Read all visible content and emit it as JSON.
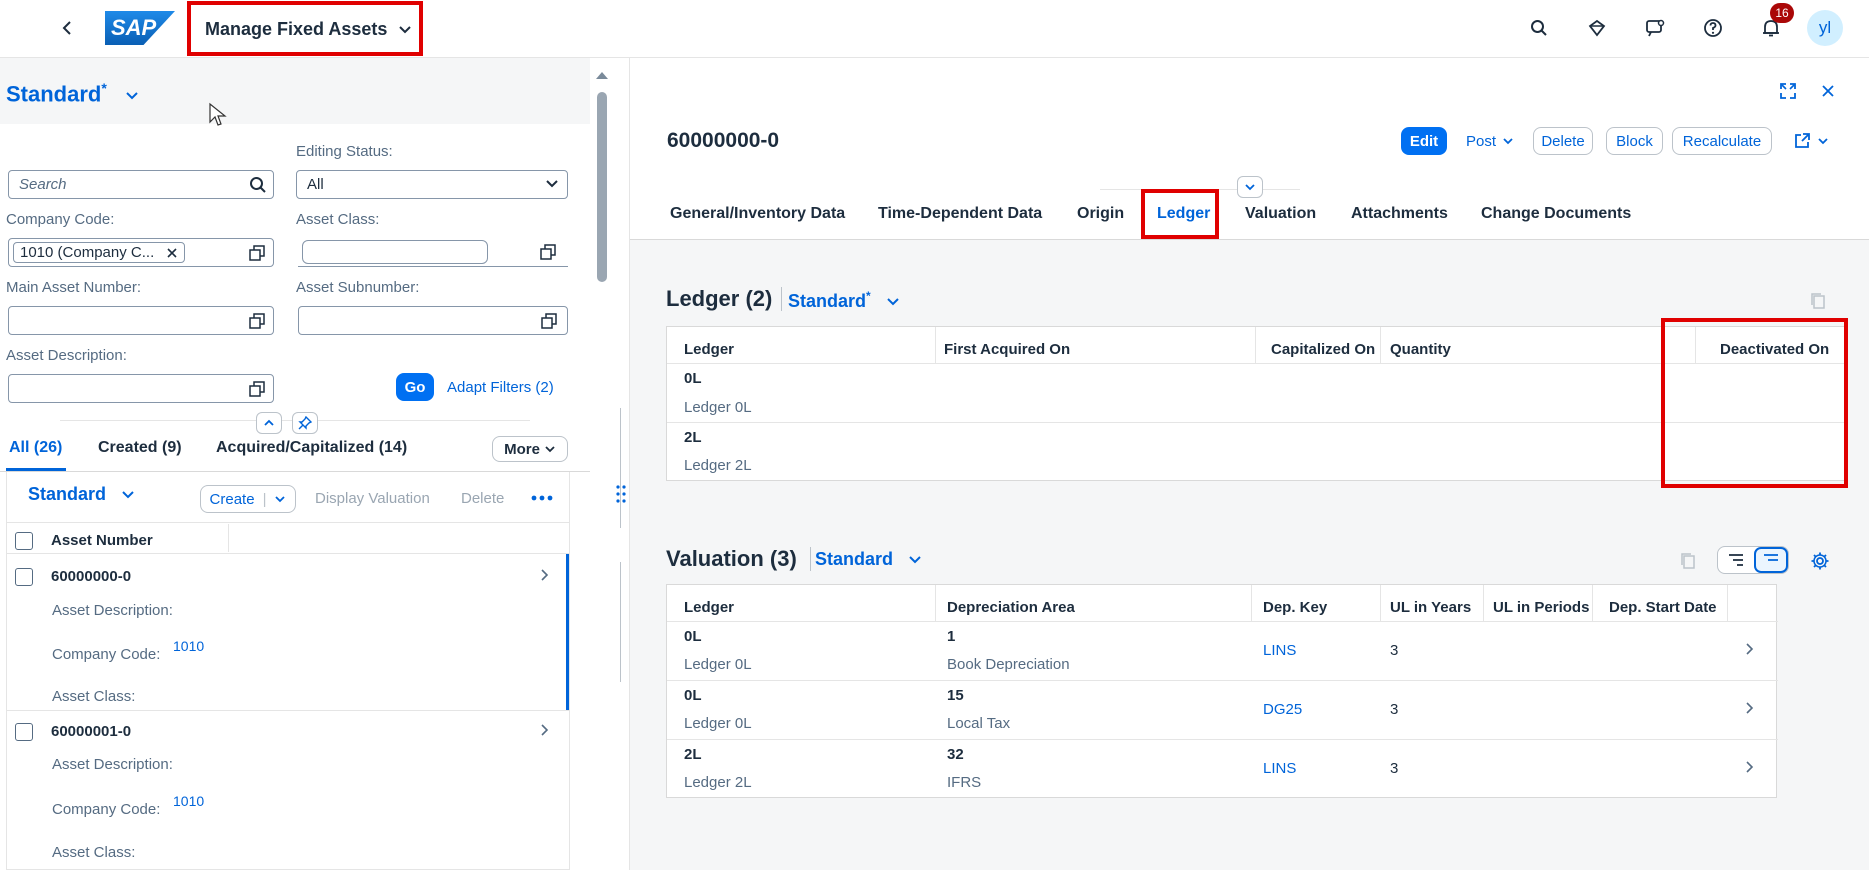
{
  "shell": {
    "logo": "SAP",
    "app_title": "Manage Fixed Assets",
    "notification_count": "16",
    "avatar": "yl"
  },
  "filterbar": {
    "variant": "Standard",
    "variant_modified": "*",
    "search_placeholder": "Search",
    "editing_status_label": "Editing Status:",
    "editing_status_value": "All",
    "company_code_label": "Company Code:",
    "company_code_token": "1010 (Company C...",
    "asset_class_label": "Asset Class:",
    "main_asset_label": "Main Asset Number:",
    "asset_subnumber_label": "Asset Subnumber:",
    "asset_description_label": "Asset Description:",
    "go": "Go",
    "adapt_filters": "Adapt Filters (2)"
  },
  "list_tabs": [
    {
      "label": "All (26)"
    },
    {
      "label": "Created (9)"
    },
    {
      "label": "Acquired/Capitalized (14)"
    }
  ],
  "list_more": "More",
  "list_toolbar": {
    "variant": "Standard",
    "create": "Create",
    "display_valuation": "Display Valuation",
    "delete": "Delete"
  },
  "list_header": "Asset Number",
  "list_items": [
    {
      "number": "60000000-0",
      "desc_label": "Asset Description:",
      "cc_label": "Company Code:",
      "cc_value": "1010",
      "class_label": "Asset Class:"
    },
    {
      "number": "60000001-0",
      "desc_label": "Asset Description:",
      "cc_label": "Company Code:",
      "cc_value": "1010",
      "class_label": "Asset Class:"
    }
  ],
  "object": {
    "title": "60000000-0",
    "actions": {
      "edit": "Edit",
      "post": "Post",
      "delete": "Delete",
      "block": "Block",
      "recalculate": "Recalculate"
    },
    "tabs": [
      "General/Inventory Data",
      "Time-Dependent Data",
      "Origin",
      "Ledger",
      "Valuation",
      "Attachments",
      "Change Documents"
    ]
  },
  "ledger_section": {
    "title": "Ledger (2)",
    "variant": "Standard",
    "variant_modified": "*",
    "columns": [
      "Ledger",
      "First Acquired On",
      "Capitalized On",
      "Quantity",
      "Deactivated On"
    ],
    "rows": [
      {
        "code": "0L",
        "name": "Ledger 0L"
      },
      {
        "code": "2L",
        "name": "Ledger 2L"
      }
    ]
  },
  "valuation_section": {
    "title": "Valuation (3)",
    "variant": "Standard",
    "columns": [
      "Ledger",
      "Depreciation Area",
      "Dep. Key",
      "UL in Years",
      "UL in Periods",
      "Dep. Start Date"
    ],
    "rows": [
      {
        "ledger": "0L",
        "ledger_name": "Ledger 0L",
        "area": "1",
        "area_name": "Book Depreciation",
        "key": "LINS",
        "years": "3"
      },
      {
        "ledger": "0L",
        "ledger_name": "Ledger 0L",
        "area": "15",
        "area_name": "Local Tax",
        "key": "DG25",
        "years": "3"
      },
      {
        "ledger": "2L",
        "ledger_name": "Ledger 2L",
        "area": "32",
        "area_name": "IFRS",
        "key": "LINS",
        "years": "3"
      }
    ]
  },
  "colors": {
    "accent": "#0064d9",
    "highlight": "#e00000",
    "badge": "#aa0808"
  }
}
